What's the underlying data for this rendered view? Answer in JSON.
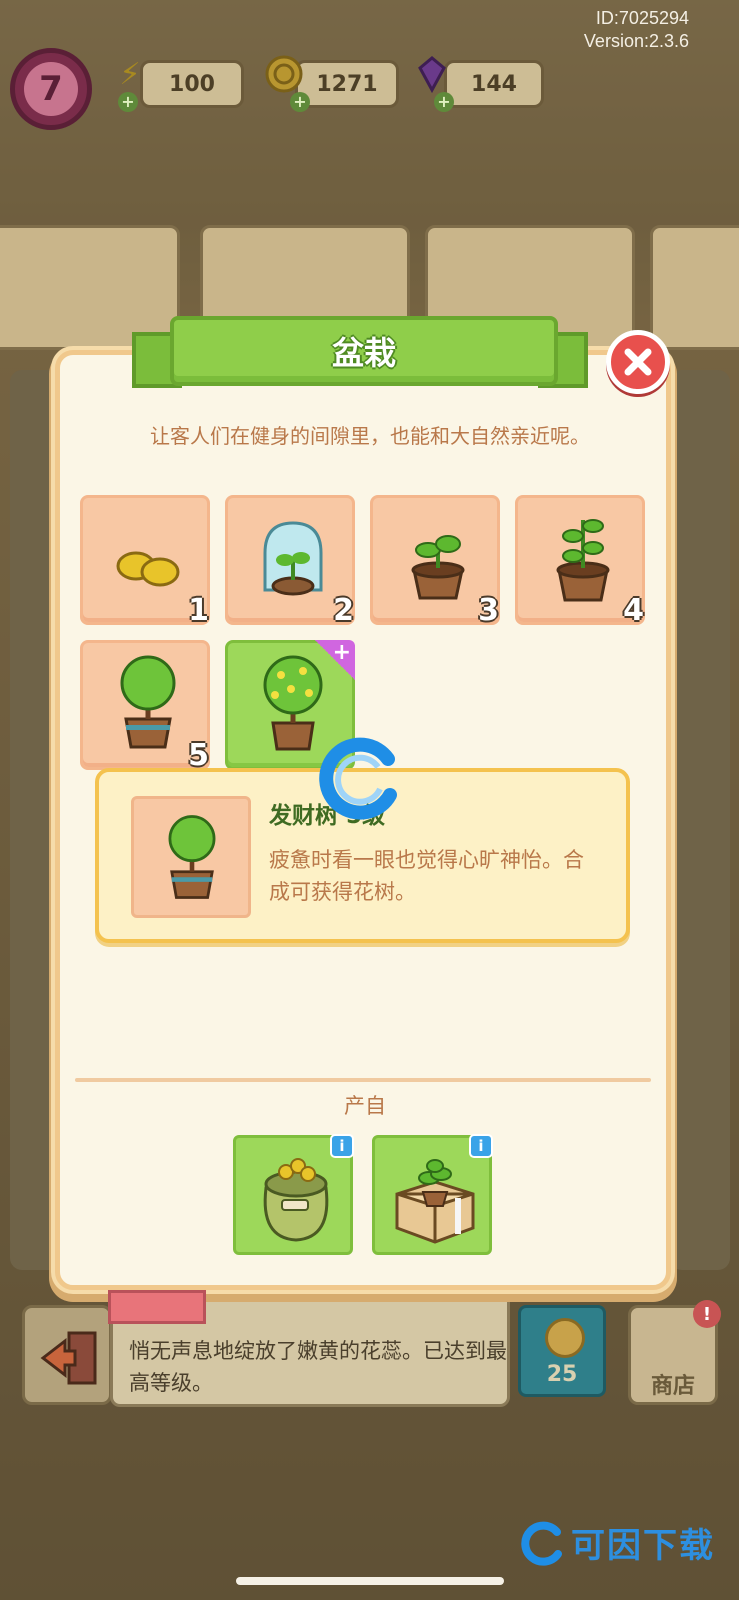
{
  "hud": {
    "id_text": "ID:7025294",
    "version_text": "Version:2.3.6",
    "level": "7",
    "energy": "100",
    "coins": "1271",
    "gems": "144"
  },
  "modal": {
    "title": "盆栽",
    "description": "让客人们在健身的间隙里，也能和大自然亲近呢。",
    "tiles": [
      {
        "level": "1",
        "icon": "seeds-icon"
      },
      {
        "level": "2",
        "icon": "sprout-in-glass-dome-icon"
      },
      {
        "level": "3",
        "icon": "sprout-pot-icon"
      },
      {
        "level": "4",
        "icon": "young-plant-pot-icon"
      },
      {
        "level": "5",
        "icon": "potted-tree-icon"
      },
      {
        "level": "",
        "icon": "flowering-tree-icon"
      }
    ],
    "info": {
      "name": "发财树 5级",
      "text": "疲惫时看一眼也觉得心旷神怡。合成可获得花树。"
    },
    "source_label": "产自",
    "sources": [
      {
        "icon": "seed-sack-icon"
      },
      {
        "icon": "plant-box-icon"
      }
    ]
  },
  "bottom_bar": {
    "message": "悄无声息地绽放了嫩黄的花蕊。已达到最高等级。",
    "price": "25",
    "shop_label": "商店"
  },
  "watermark": {
    "text": "可因下载"
  },
  "colors": {
    "ribbon_green": "#8fce4a",
    "close_red": "#e8504d",
    "tile_peach": "#f8c8a4",
    "tile_selected_green": "#9dd85a",
    "panel_yellow": "#fdf1c6",
    "desc_brown": "#b9784a"
  }
}
